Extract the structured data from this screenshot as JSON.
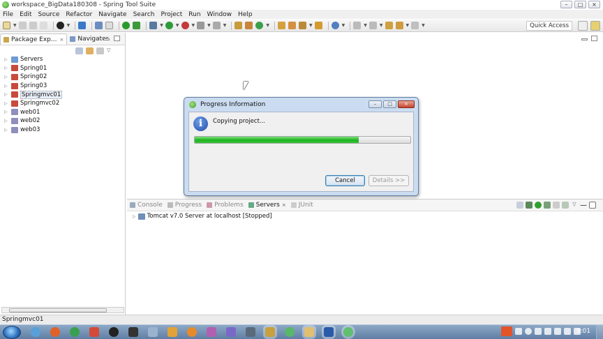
{
  "window": {
    "title": "workspace_BigData180308 - Spring Tool Suite",
    "controls": [
      "–",
      "□",
      "×"
    ]
  },
  "menu": [
    "File",
    "Edit",
    "Source",
    "Refactor",
    "Navigate",
    "Search",
    "Project",
    "Run",
    "Window",
    "Help"
  ],
  "toolbar": {
    "quick_access": "Quick Access"
  },
  "left_panel": {
    "tabs": [
      {
        "label": "Package Exp...",
        "close": "×"
      },
      {
        "label": "Navigator"
      }
    ],
    "tree": [
      {
        "label": "Servers",
        "icon": "folder-icon"
      },
      {
        "label": "Spring01",
        "icon": "spring-project-icon"
      },
      {
        "label": "Spring02",
        "icon": "spring-project-icon"
      },
      {
        "label": "Spring03",
        "icon": "spring-project-icon"
      },
      {
        "label": "Springmvc01",
        "icon": "spring-project-icon",
        "selected": true
      },
      {
        "label": "Springmvc02",
        "icon": "spring-project-icon"
      },
      {
        "label": "web01",
        "icon": "web-project-icon"
      },
      {
        "label": "web02",
        "icon": "web-project-icon"
      },
      {
        "label": "web03",
        "icon": "web-project-icon"
      }
    ]
  },
  "bottom_panel": {
    "tabs": [
      {
        "label": "Console",
        "active": false
      },
      {
        "label": "Progress",
        "active": false
      },
      {
        "label": "Problems",
        "active": false
      },
      {
        "label": "Servers",
        "active": true,
        "close": "×"
      },
      {
        "label": "JUnit",
        "active": false
      }
    ],
    "server_row": "Tomcat v7.0 Server at localhost  [Stopped]"
  },
  "status_bar": {
    "selection": "Springmvc01"
  },
  "dialog": {
    "title": "Progress Information",
    "message": "Copying project...",
    "progress_percent": 76,
    "cancel_label": "Cancel",
    "details_label": "Details >>",
    "controls": [
      "–",
      "□",
      "×"
    ]
  },
  "taskbar": {
    "clock": "9:01"
  },
  "colors": {
    "progress_green": "#1fb21f",
    "dialog_frame": "#cbdcf0",
    "taskbar": "#6f8db2"
  }
}
